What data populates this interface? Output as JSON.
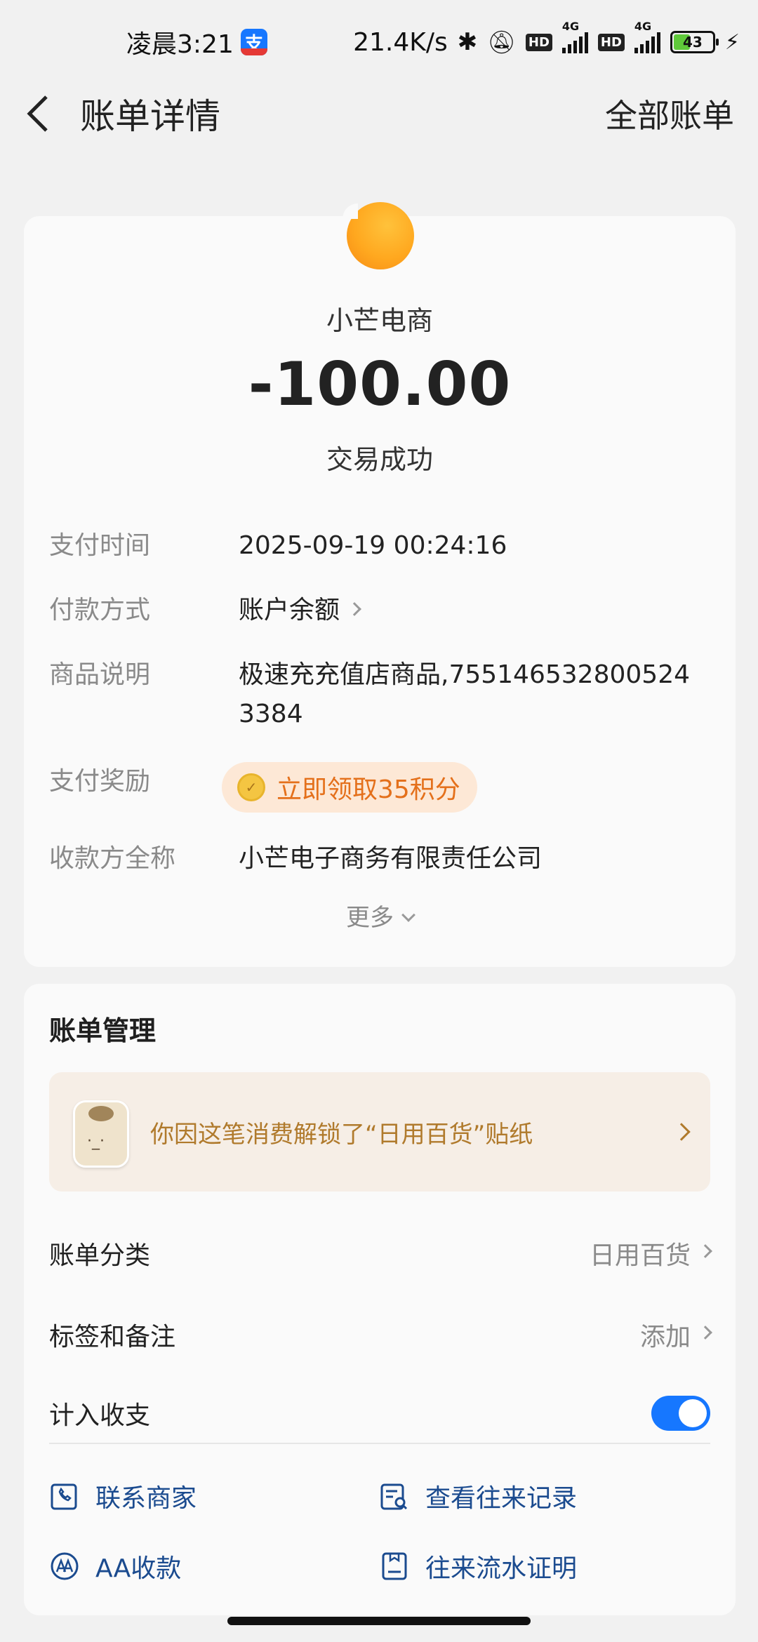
{
  "status_bar": {
    "time": "凌晨3:21",
    "network_speed": "21.4K/s",
    "net_type_1": "4G",
    "net_type_2": "4G",
    "hd_label": "HD",
    "battery": "43"
  },
  "header": {
    "title": "账单详情",
    "right_link": "全部账单"
  },
  "bill": {
    "merchant": "小芒电商",
    "amount": "-100.00",
    "status": "交易成功",
    "rows": [
      {
        "label": "支付时间",
        "value": "2025-09-19 00:24:16"
      },
      {
        "label": "付款方式",
        "value": "账户余额"
      },
      {
        "label": "商品说明",
        "value": "极速充充值店商品,7551465328005243384"
      },
      {
        "label": "支付奖励",
        "value": "立即领取35积分"
      },
      {
        "label": "收款方全称",
        "value": "小芒电子商务有限责任公司"
      }
    ],
    "more": "更多"
  },
  "manage": {
    "title": "账单管理",
    "banner": "你因这笔消费解锁了“日用百货”贴纸",
    "category_label": "账单分类",
    "category_value": "日用百货",
    "tag_label": "标签和备注",
    "tag_value": "添加",
    "count_label": "计入收支",
    "count_enabled": true,
    "actions": [
      {
        "label": "联系商家",
        "icon": "phone-icon"
      },
      {
        "label": "查看往来记录",
        "icon": "records-icon"
      },
      {
        "label": "AA收款",
        "icon": "aa-icon"
      },
      {
        "label": "往来流水证明",
        "icon": "certificate-icon"
      }
    ]
  },
  "colors": {
    "accent": "#1677ff",
    "reward_text": "#e4701b",
    "banner_text": "#b07a2c",
    "action_text": "#1b4b8f"
  }
}
